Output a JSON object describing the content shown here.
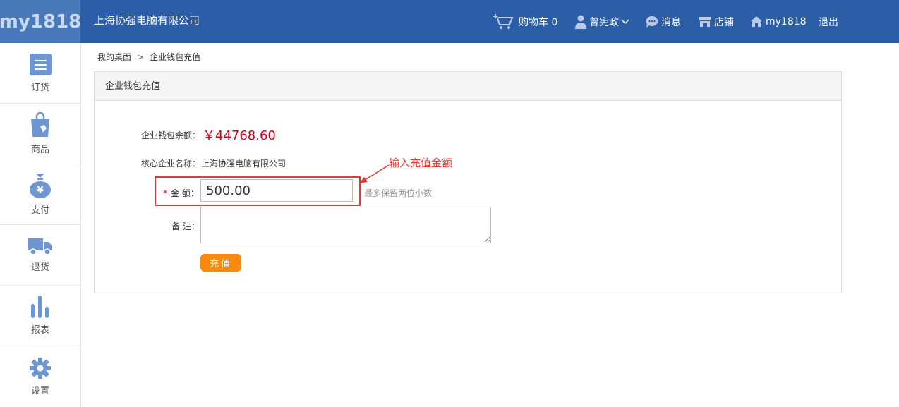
{
  "header": {
    "logo": "my1818",
    "company": "上海协强电脑有限公司",
    "nav": {
      "cart": "购物车 0",
      "user": "曾宪政",
      "messages": "消息",
      "shop": "店铺",
      "home": "my1818",
      "logout": "退出"
    }
  },
  "sidebar": {
    "items": [
      {
        "label": "订货",
        "icon": "list-icon"
      },
      {
        "label": "商品",
        "icon": "shopping-bag-icon"
      },
      {
        "label": "支付",
        "icon": "money-bag-icon"
      },
      {
        "label": "退货",
        "icon": "truck-icon"
      },
      {
        "label": "报表",
        "icon": "bar-chart-icon"
      },
      {
        "label": "设置",
        "icon": "gear-icon"
      }
    ]
  },
  "breadcrumb": {
    "home": "我的桌面",
    "separator": ">",
    "current": "企业钱包充值"
  },
  "panel": {
    "title": "企业钱包充值",
    "balance_label": "企业钱包余额：",
    "balance_value": "￥44768.60",
    "company_label": "核心企业名称：",
    "company_value": "上海协强电脑有限公司",
    "amount_star": "*",
    "amount_label": "金 额：",
    "amount_value": "500.00",
    "amount_hint": "最多保留两位小数",
    "remark_label": "备 注：",
    "remark_value": "",
    "submit_label": "充值"
  },
  "annotation": {
    "text": "输入充值金额",
    "color": "#e53935"
  },
  "colors": {
    "header_bg": "#2b5ea7",
    "logo_bg": "#4a79bb",
    "sidebar_icon": "#6e96d2",
    "balance": "#d0021b",
    "submit_bg": "#f98a0d"
  }
}
